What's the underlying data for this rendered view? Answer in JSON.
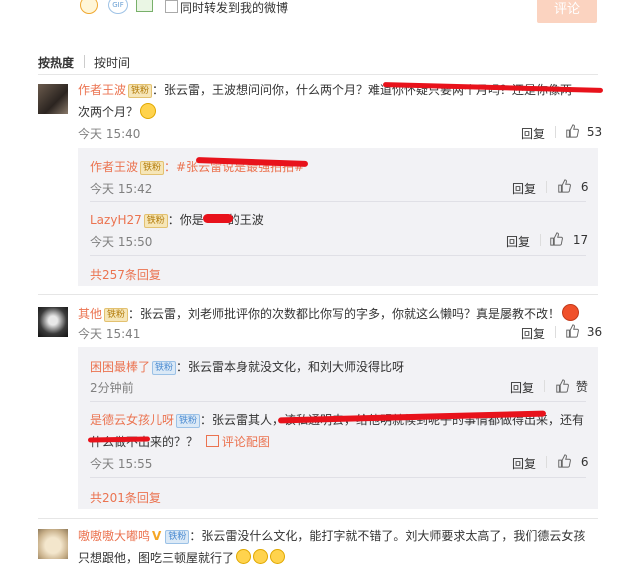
{
  "composer": {
    "forward_label": "同时转发到我的微博",
    "submit_label": "评论"
  },
  "sort": {
    "by_hot": "按热度",
    "by_time": "按时间"
  },
  "actions": {
    "reply": "回复",
    "praise": "赞"
  },
  "c1": {
    "user": "作者王波",
    "colon": "：",
    "badge": "铁粉",
    "text_a": "张云雷，王波想问问你，什么两个月？难道你怀疑只要两个月吗？还是你像两",
    "text_b": "次两个月？",
    "time": "今天 15:40",
    "likes": "53",
    "r1": {
      "user": "作者王波",
      "badge": "铁粉",
      "text": "：#张云雷说是最强拍拍#",
      "time": "今天 15:42",
      "likes": "6"
    },
    "r2": {
      "user": "LazyH27",
      "badge": "铁粉",
      "text_a": "：你是",
      "text_b": "的王波",
      "time": "今天 15:50",
      "likes": "17"
    },
    "more": "共257条回复"
  },
  "c2": {
    "user": "其他",
    "badge": "铁粉",
    "text": "：张云雷，刘老师批评你的次数都比你写的字多，你就这么懒吗？真是屡教不改！",
    "time": "今天 15:41",
    "likes": "36",
    "r1": {
      "user": "困困最棒了",
      "badge": "铁粉",
      "text": "：张云雷本身就没文化，和刘大师没得比呀",
      "time": "2分钟前"
    },
    "r2": {
      "user": "是德云女孩儿呀",
      "badge": "铁粉",
      "text_a": "：张云雷其人，该私通明去，给他明就候到呢子的事情都做得出来，还有",
      "text_b": "什么做不出来的？？",
      "image_link": "评论配图",
      "time": "今天 15:55",
      "likes": "6"
    },
    "more": "共201条回复"
  },
  "c3": {
    "user": "嗷嗷嗷大嘟鸣",
    "badge": "铁粉",
    "text_a": "：张云雷没什么文化，能打字就不错了。刘大师要求太高了，我们德云女孩",
    "text_b": "只想跟他，图吃三顿屋就行了"
  },
  "colors": {
    "accent": "#eb7350",
    "redact": "#e8121b",
    "sub_bg": "#f2f2f5"
  }
}
